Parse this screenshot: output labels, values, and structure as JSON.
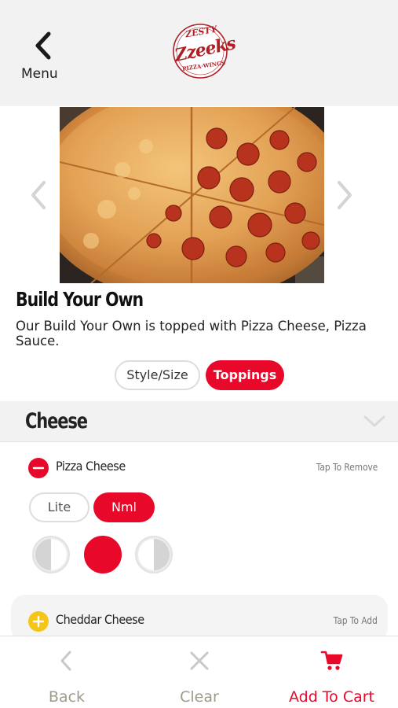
{
  "header": {
    "back_label": "Menu",
    "logo": {
      "top": "ZESTY",
      "main": "Zzeeks",
      "bottom": "PIZZA·WINGS"
    }
  },
  "product": {
    "title": "Build Your Own",
    "description": "Our Build Your Own is topped with Pizza Cheese, Pizza Sauce."
  },
  "tabs": [
    {
      "label": "Style/Size",
      "selected": false
    },
    {
      "label": "Toppings",
      "selected": true
    }
  ],
  "section": {
    "title": "Cheese"
  },
  "toppings": [
    {
      "name": "Pizza Cheese",
      "action": "Tap To Remove",
      "selected": true,
      "amounts": [
        {
          "label": "Lite",
          "selected": false
        },
        {
          "label": "Nml",
          "selected": true
        }
      ],
      "portions": [
        "left-half",
        "whole",
        "right-half"
      ],
      "selected_portion": "whole"
    },
    {
      "name": "Cheddar Cheese",
      "action": "Tap To Add",
      "selected": false
    }
  ],
  "bottom_bar": {
    "back_label": "Back",
    "clear_label": "Clear",
    "add_to_cart_label": "Add To Cart"
  },
  "colors": {
    "accent_red": "#e8082a",
    "brand_red": "#b01e23",
    "add_yellow": "#f5c518",
    "header_bg": "#f2f2f2",
    "muted_label": "#a09a8a"
  },
  "icons": [
    "chevron-left-icon",
    "chevron-right-icon",
    "chevron-down-icon",
    "minus-circle-icon",
    "plus-circle-icon",
    "close-icon",
    "cart-icon"
  ]
}
